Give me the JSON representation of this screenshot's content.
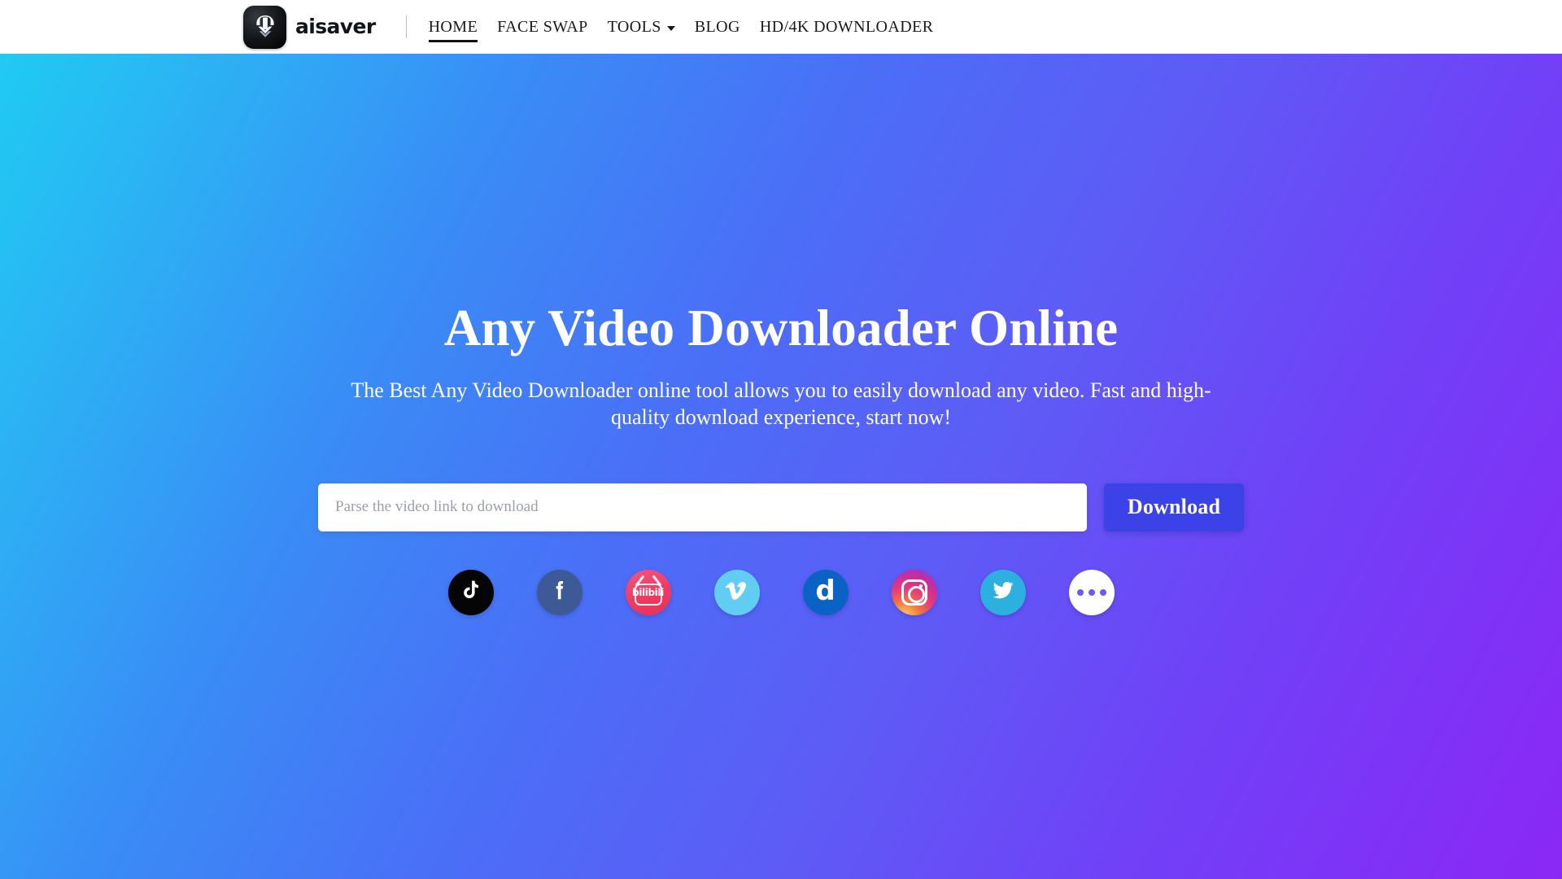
{
  "header": {
    "brand": {
      "logo_icon": "download-arrow-logo-icon",
      "name": "aisaver"
    },
    "nav": [
      {
        "label": "HOME",
        "active": true,
        "has_dropdown": false
      },
      {
        "label": "FACE SWAP",
        "active": false,
        "has_dropdown": false
      },
      {
        "label": "TOOLS",
        "active": false,
        "has_dropdown": true
      },
      {
        "label": "BLOG",
        "active": false,
        "has_dropdown": false
      },
      {
        "label": "HD/4K DOWNLOADER",
        "active": false,
        "has_dropdown": false
      }
    ]
  },
  "hero": {
    "title": "Any Video Downloader Online",
    "subtitle": "The Best Any Video Downloader online tool allows you to easily download any video. Fast and high-quality download experience, start now!",
    "search": {
      "placeholder": "Parse the video link to download",
      "value": ""
    },
    "download_button": "Download",
    "platforms": [
      {
        "name": "TikTok",
        "icon": "tiktok-icon",
        "color": "#050505"
      },
      {
        "name": "Facebook",
        "icon": "facebook-icon",
        "color": "#3d5a96"
      },
      {
        "name": "bilibili",
        "icon": "bilibili-icon",
        "color": "#ef3a62",
        "wordmark": "bilibili"
      },
      {
        "name": "Vimeo",
        "icon": "vimeo-icon",
        "color": "#62cdf2"
      },
      {
        "name": "Dailymotion",
        "icon": "dailymotion-icon",
        "color": "#0a63c4",
        "wordmark": "d"
      },
      {
        "name": "Instagram",
        "icon": "instagram-icon",
        "color": "#e5387e"
      },
      {
        "name": "Twitter",
        "icon": "twitter-icon",
        "color": "#2cb0e0"
      },
      {
        "name": "More",
        "icon": "more-dots-icon",
        "color": "#ffffff"
      }
    ]
  },
  "theme": {
    "gradient_start": "#1fcbf2",
    "gradient_mid": "#5d5cf6",
    "gradient_end": "#8b27f6",
    "accent_button": "#3b43e8",
    "header_bg": "#ffffff",
    "text_on_hero": "#ffffff"
  }
}
